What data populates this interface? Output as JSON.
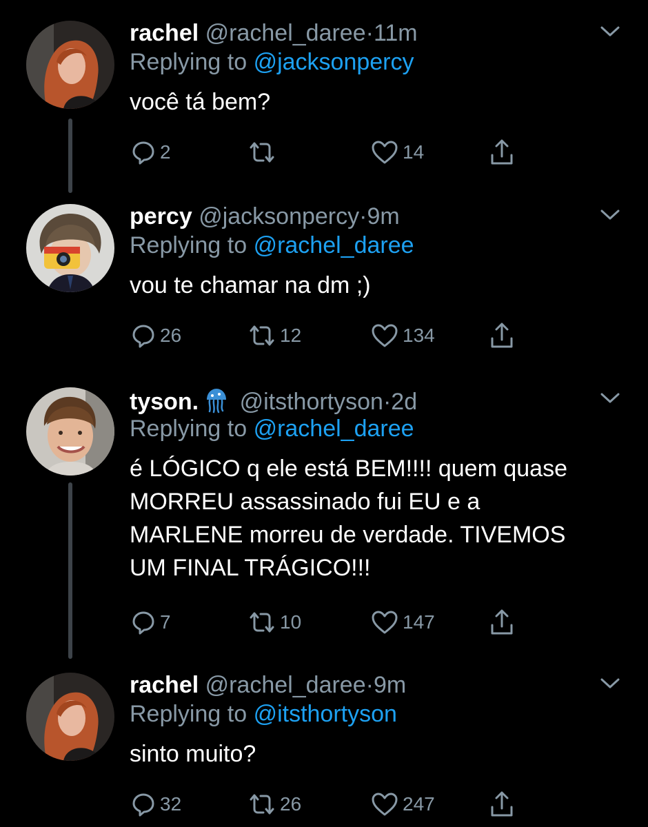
{
  "colors": {
    "background": "#000000",
    "text_primary": "#ffffff",
    "text_secondary": "#8899a6",
    "link": "#1da1f2",
    "thread_line": "#3d4349"
  },
  "tweets": [
    {
      "name": "rachel",
      "handle": "@rachel_daree",
      "separator": "·",
      "time": "11m",
      "replying_label": "Replying to",
      "replying_to": "@jacksonpercy",
      "text": "você tá bem?",
      "avatar_icon": "avatar-red-hair",
      "reply_count": "2",
      "retweet_count": "",
      "like_count": "14"
    },
    {
      "name": "percy",
      "handle": "@jacksonpercy",
      "separator": "·",
      "time": "9m",
      "replying_label": "Replying to",
      "replying_to": "@rachel_daree",
      "text": "vou te chamar na dm ;)",
      "avatar_icon": "avatar-curly-hair-camera",
      "reply_count": "26",
      "retweet_count": "12",
      "like_count": "134"
    },
    {
      "name": "tyson.",
      "name_emoji": "jellyfish-icon",
      "handle": "@itsthortyson",
      "separator": "·",
      "time": "2d",
      "replying_label": "Replying to",
      "replying_to": "@rachel_daree",
      "text_lines": [
        "é LÓGICO q ele está BEM!!!! quem quase",
        "MORREU assassinado fui EU e a",
        "MARLENE morreu de verdade. TIVEMOS",
        "UM FINAL TRÁGICO!!!"
      ],
      "avatar_icon": "avatar-smiling-boy",
      "reply_count": "7",
      "retweet_count": "10",
      "like_count": "147"
    },
    {
      "name": "rachel",
      "handle": "@rachel_daree",
      "separator": "·",
      "time": "9m",
      "replying_label": "Replying to",
      "replying_to": "@itsthortyson",
      "text": "sinto muito?",
      "avatar_icon": "avatar-red-hair",
      "reply_count": "32",
      "retweet_count": "26",
      "like_count": "247"
    }
  ]
}
